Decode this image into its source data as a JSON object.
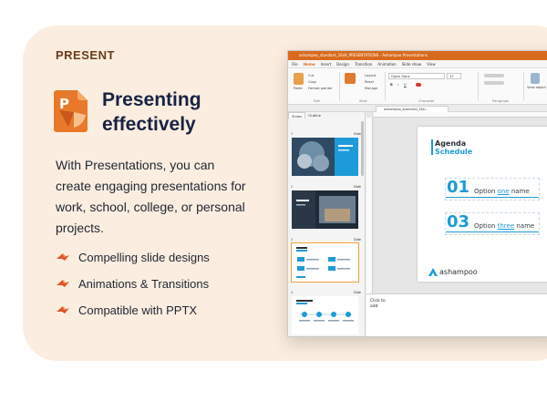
{
  "section_label": "PRESENT",
  "headline": [
    "Presenting",
    "effectively"
  ],
  "description": "With Presentations, you can create engaging presentations for work, school, college, or personal projects.",
  "features": [
    "Compelling slide designs",
    "Animations & Transitions",
    "Compatible with PPTX"
  ],
  "colors": {
    "card_bg": "#fbeee0",
    "brand_orange": "#d96a1d",
    "slide_blue": "#1d9bd8",
    "headline": "#172243"
  },
  "app_window": {
    "title": "ashampoo_standard_16x9_PRESENTATIONS - Ashampoo Presentations",
    "menu": [
      "File",
      "Home",
      "Insert",
      "Design",
      "Transition",
      "Animation",
      "Slide show",
      "View"
    ],
    "active_menu": "Home",
    "ribbon": {
      "paste_label": "Paste",
      "cut_label": "Cut",
      "copy_label": "Copy",
      "format_painter_label": "Format painter",
      "layout_label": "Layout",
      "reset_label": "Reset",
      "manage_label": "Manage",
      "font_name": "Open Sans",
      "font_size": "17",
      "edit_group": "Edit",
      "slide_group": "Slide",
      "character_group": "Character",
      "paragraph_group": "Paragraph",
      "view_object_label": "View object"
    },
    "doc_tab": "ashampoo_standard_16x...",
    "pane_tabs": [
      "Slides",
      "Outline"
    ],
    "thumb_name": "Slide",
    "thumb_numbers": [
      "1",
      "2",
      "3",
      "4"
    ],
    "slide": {
      "title_line1": "Agenda",
      "title_line2": "Schedule",
      "options": [
        {
          "num": "01",
          "label": "Option",
          "link": "one",
          "suffix": "name"
        },
        {
          "num": "03",
          "label": "Option",
          "link": "three",
          "suffix": "name"
        }
      ],
      "logo_text": "ashampoo"
    },
    "notes_placeholder": [
      "Click to",
      "add"
    ]
  }
}
